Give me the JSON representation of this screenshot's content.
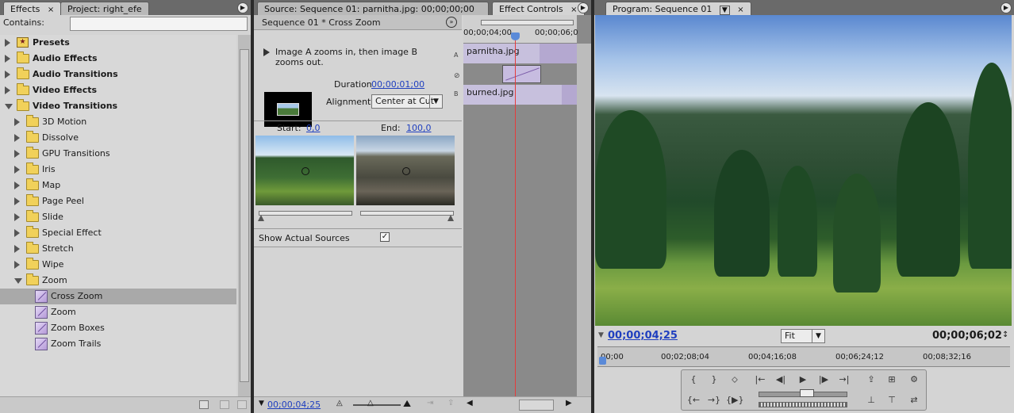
{
  "effects_panel": {
    "tabs": [
      {
        "label": "Effects",
        "close": "×"
      },
      {
        "label": "Project: right_efe"
      }
    ],
    "contains_label": "Contains:",
    "search_value": "",
    "tree": [
      {
        "label": "Presets",
        "bold": true,
        "icon": "preset",
        "depth": 0,
        "state": "closed"
      },
      {
        "label": "Audio Effects",
        "bold": true,
        "icon": "folder",
        "depth": 0,
        "state": "closed"
      },
      {
        "label": "Audio Transitions",
        "bold": true,
        "icon": "folder",
        "depth": 0,
        "state": "closed"
      },
      {
        "label": "Video Effects",
        "bold": true,
        "icon": "folder",
        "depth": 0,
        "state": "closed"
      },
      {
        "label": "Video Transitions",
        "bold": true,
        "icon": "folder",
        "depth": 0,
        "state": "open"
      },
      {
        "label": "3D Motion",
        "icon": "folder",
        "depth": 1,
        "state": "closed"
      },
      {
        "label": "Dissolve",
        "icon": "folder",
        "depth": 1,
        "state": "closed"
      },
      {
        "label": "GPU Transitions",
        "icon": "folder",
        "depth": 1,
        "state": "closed"
      },
      {
        "label": "Iris",
        "icon": "folder",
        "depth": 1,
        "state": "closed"
      },
      {
        "label": "Map",
        "icon": "folder",
        "depth": 1,
        "state": "closed"
      },
      {
        "label": "Page Peel",
        "icon": "folder",
        "depth": 1,
        "state": "closed"
      },
      {
        "label": "Slide",
        "icon": "folder",
        "depth": 1,
        "state": "closed"
      },
      {
        "label": "Special Effect",
        "icon": "folder",
        "depth": 1,
        "state": "closed"
      },
      {
        "label": "Stretch",
        "icon": "folder",
        "depth": 1,
        "state": "closed"
      },
      {
        "label": "Wipe",
        "icon": "folder",
        "depth": 1,
        "state": "closed"
      },
      {
        "label": "Zoom",
        "icon": "folder",
        "depth": 1,
        "state": "open"
      },
      {
        "label": "Cross Zoom",
        "icon": "transition",
        "depth": 2,
        "selected": true
      },
      {
        "label": "Zoom",
        "icon": "transition",
        "depth": 2
      },
      {
        "label": "Zoom Boxes",
        "icon": "transition",
        "depth": 2
      },
      {
        "label": "Zoom Trails",
        "icon": "transition",
        "depth": 2
      }
    ]
  },
  "effect_controls": {
    "tabs": [
      {
        "label": "Source: Sequence 01: parnitha.jpg: 00;00;00;00"
      },
      {
        "label": "Effect Controls",
        "close": "×"
      }
    ],
    "header": "Sequence 01 * Cross Zoom",
    "description": "Image A zooms in, then image B zooms out.",
    "duration_label": "Duration",
    "duration_value": "00;00;01;00",
    "alignment_label": "Alignment:",
    "alignment_value": "Center at Cut",
    "track_letters": [
      "A",
      "B"
    ],
    "start_label": "Start:",
    "start_value": "0,0",
    "end_label": "End:",
    "end_value": "100,0",
    "show_sources_label": "Show Actual Sources",
    "show_sources_checked": true,
    "ruler": [
      "00;00;04;00",
      "00;00;06;0"
    ],
    "clip_a": "parnitha.jpg",
    "clip_b": "burned.jpg",
    "current_time": "00;00;04;25"
  },
  "program_monitor": {
    "tab_label": "Program: Sequence 01",
    "current_time": "00;00;04;25",
    "zoom_value": "Fit",
    "duration": "00;00;06;02",
    "ruler": [
      "00;00",
      "00;02;08;04",
      "00;04;16;08",
      "00;06;24;12",
      "00;08;32;16"
    ],
    "colors": {
      "timecode": "#1f3fbf",
      "playhead": "#e53b3b"
    }
  }
}
